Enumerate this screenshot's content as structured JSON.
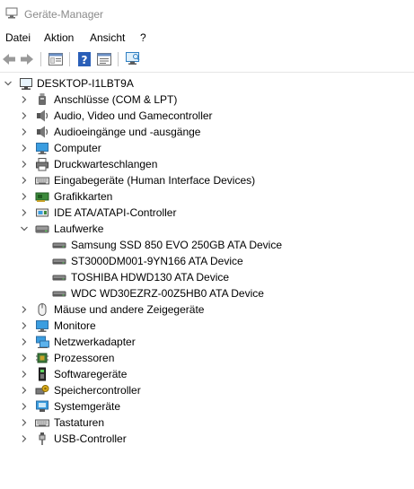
{
  "window": {
    "title": "Geräte-Manager"
  },
  "menu": {
    "file": "Datei",
    "action": "Aktion",
    "view": "Ansicht",
    "help": "?"
  },
  "tree": {
    "root": "DESKTOP-I1LBT9A",
    "categories": [
      {
        "label": "Anschlüsse (COM & LPT)",
        "icon": "port-icon"
      },
      {
        "label": "Audio, Video und Gamecontroller",
        "icon": "speaker-icon"
      },
      {
        "label": "Audioeingänge und -ausgänge",
        "icon": "speaker-icon"
      },
      {
        "label": "Computer",
        "icon": "monitor-icon"
      },
      {
        "label": "Druckwarteschlangen",
        "icon": "printer-icon"
      },
      {
        "label": "Eingabegeräte (Human Interface Devices)",
        "icon": "keyboard-icon"
      },
      {
        "label": "Grafikkarten",
        "icon": "graphics-card-icon"
      },
      {
        "label": "IDE ATA/ATAPI-Controller",
        "icon": "controller-icon"
      },
      {
        "label": "Laufwerke",
        "icon": "disk-drive-icon",
        "expanded": true,
        "children": [
          "Samsung SSD 850 EVO 250GB ATA Device",
          "ST3000DM001-9YN166 ATA Device",
          "TOSHIBA HDWD130 ATA Device",
          "WDC WD30EZRZ-00Z5HB0 ATA Device"
        ]
      },
      {
        "label": "Mäuse und andere Zeigegeräte",
        "icon": "mouse-icon"
      },
      {
        "label": "Monitore",
        "icon": "monitor-icon"
      },
      {
        "label": "Netzwerkadapter",
        "icon": "network-adapter-icon"
      },
      {
        "label": "Prozessoren",
        "icon": "processor-icon"
      },
      {
        "label": "Softwaregeräte",
        "icon": "software-device-icon"
      },
      {
        "label": "Speichercontroller",
        "icon": "storage-controller-icon"
      },
      {
        "label": "Systemgeräte",
        "icon": "system-device-icon"
      },
      {
        "label": "Tastaturen",
        "icon": "keyboard-icon"
      },
      {
        "label": "USB-Controller",
        "icon": "usb-icon"
      }
    ]
  }
}
